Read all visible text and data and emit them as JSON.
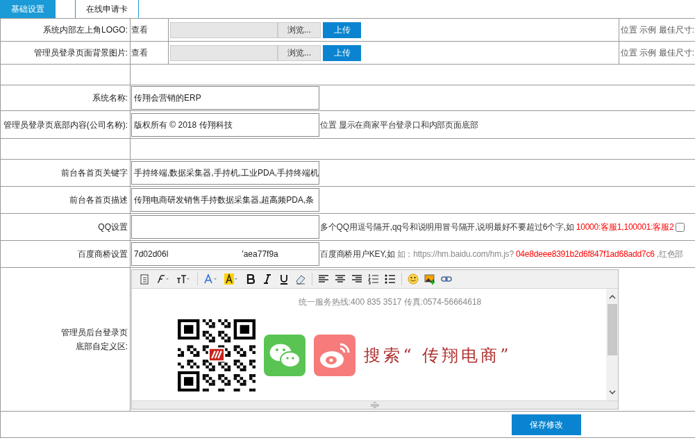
{
  "tabs": [
    {
      "label": "基础设置",
      "selected": true
    },
    {
      "label": "在线申请卡",
      "selected": false
    }
  ],
  "rows": [
    {
      "kind": "upload",
      "label": "系统内部左上角LOGO:",
      "view_link": "查看",
      "browse_button": "浏览...",
      "upload_button": "上传",
      "note": "位置 示例 最佳尺寸:"
    },
    {
      "kind": "upload",
      "label": "管理员登录页面背景图片:",
      "view_link": "查看",
      "browse_button": "浏览...",
      "upload_button": "上传",
      "note": "位置 示例 最佳尺寸:"
    },
    {
      "kind": "blank"
    },
    {
      "kind": "text",
      "label": "系统名称:",
      "value": [
        "传翔会营销的ERP"
      ]
    },
    {
      "kind": "text",
      "label": "管理员登录页底部内容(公司名称):",
      "value": [
        "版权所有 © 2018 传翔科技"
      ],
      "hint": [
        {
          "text": "位置 显示在商家平台登录口和内部页面底部",
          "color": "#333333"
        }
      ]
    },
    {
      "kind": "blank"
    },
    {
      "kind": "text",
      "label": "前台各首页关键字",
      "value": [
        "手持终端,数据采集器,手持机,工业PDA,手持终端机"
      ]
    },
    {
      "kind": "text",
      "label": "前台各首页描述",
      "value": [
        "传翔电商研发销售手持数据采集器,超高频PDA,条"
      ]
    },
    {
      "kind": "text",
      "label": "QQ设置",
      "hint": [
        {
          "text": "多个QQ用逗号隔开,qq号和说明用冒号隔开,说明最好不要超过6个字,如",
          "color": "#333333"
        },
        {
          "text": "10000:客服1,100001:客服2",
          "color": "#ff0000"
        }
      ],
      "checkbox": {
        "checked": false
      }
    },
    {
      "kind": "text",
      "label": "百度商桥设置",
      "value": [
        "7d02d06l",
        "'aea77f9a"
      ],
      "hint": [
        {
          "text": "百度商桥用户KEY,如",
          "color": "#333333"
        },
        {
          "text": "如：https://hm.baidu.com/hm.js?",
          "color": "#888888"
        },
        {
          "text": "04e8deee8391b2d6f847f1ad68add7c6",
          "color": "#ff0000"
        },
        {
          "text": ",红色部",
          "color": "#888888"
        }
      ]
    },
    {
      "kind": "editor",
      "label": "管理员后台登录页底部自定义区:",
      "hotline": "统一服务热线:400 835 3517 传真:0574-56664618",
      "slogan": "搜索“ 传翔电商”"
    }
  ],
  "save_button": "保存修改"
}
